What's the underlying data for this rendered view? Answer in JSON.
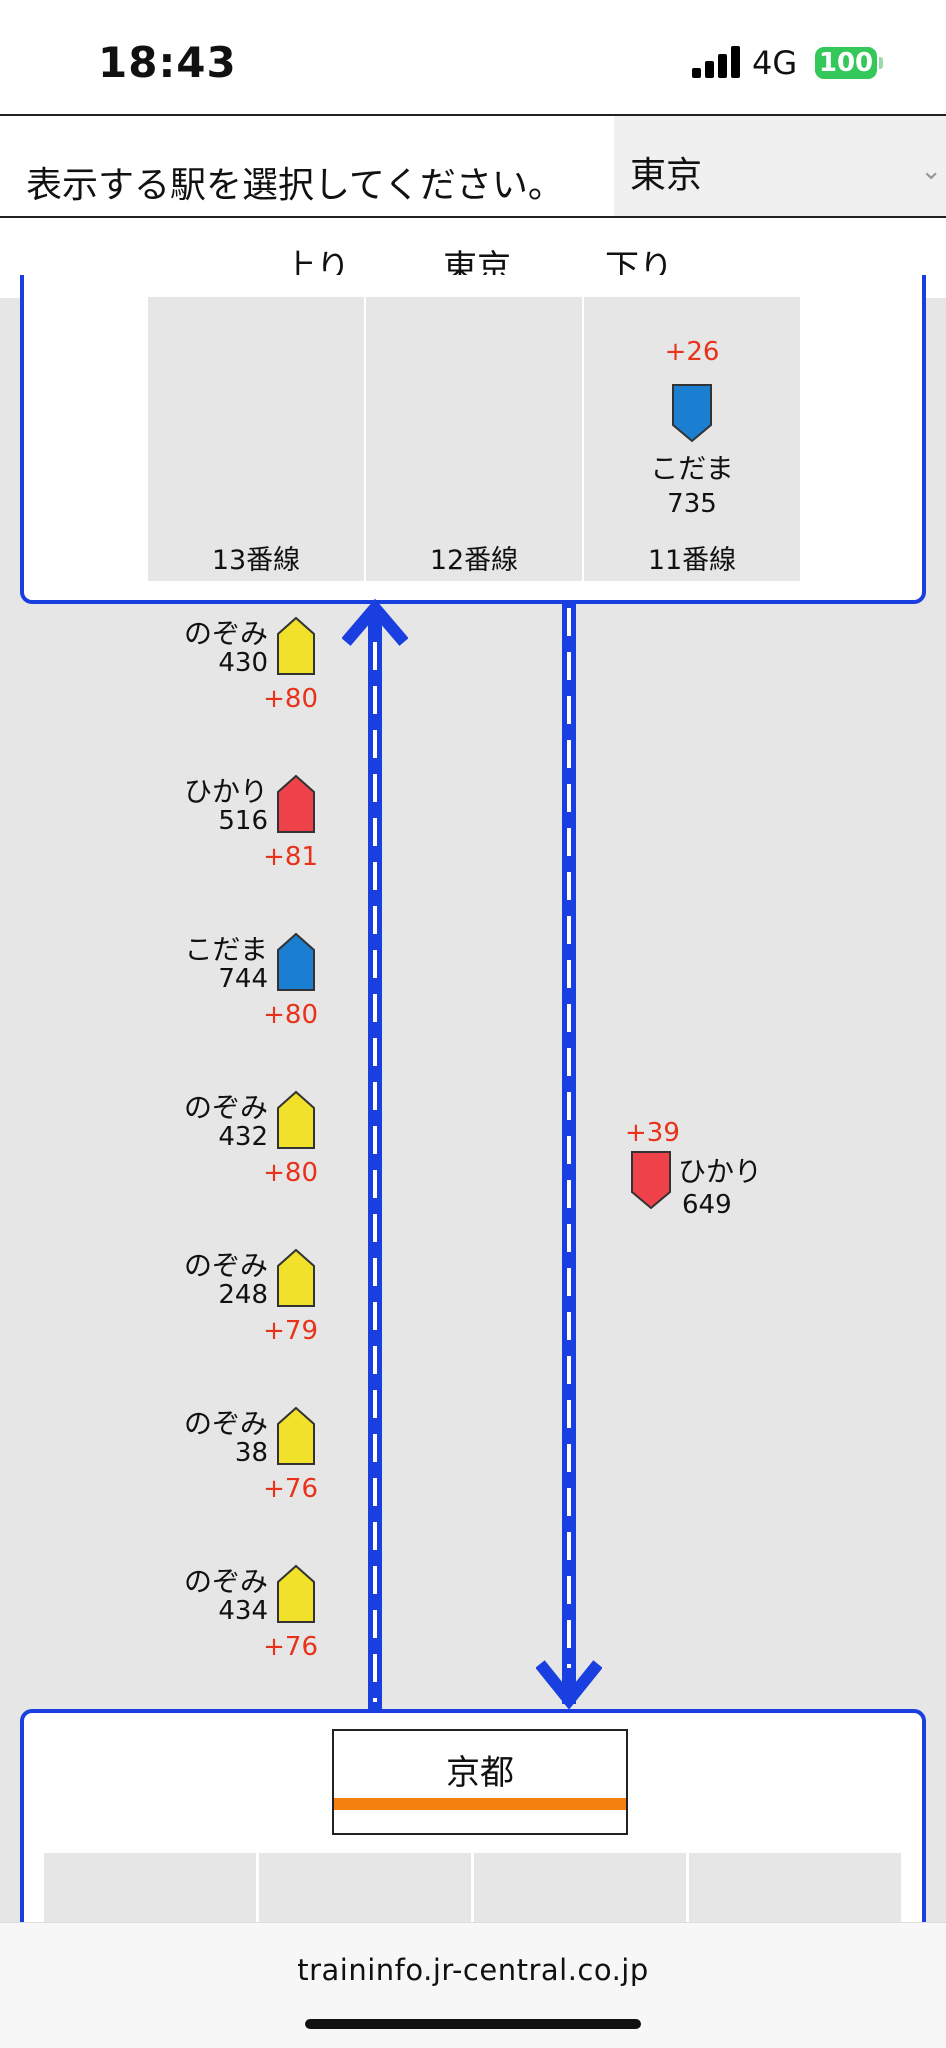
{
  "status": {
    "time": "18:43",
    "network": "4G",
    "battery": "100"
  },
  "selector": {
    "label": "表示する駅を選択してください。",
    "value": "東京"
  },
  "directions": {
    "up": "上り",
    "station": "東京",
    "down": "下り"
  },
  "tokyo": {
    "tracks": [
      "13番線",
      "12番線",
      "11番線"
    ],
    "train": {
      "name": "こだま",
      "number": "735",
      "delay": "+26",
      "color": "#1a7fd0"
    }
  },
  "up_trains": [
    {
      "name": "のぞみ",
      "number": "430",
      "delay": "+80",
      "color": "#f1e12a"
    },
    {
      "name": "ひかり",
      "number": "516",
      "delay": "+81",
      "color": "#f0424a"
    },
    {
      "name": "こだま",
      "number": "744",
      "delay": "+80",
      "color": "#1a7fd0"
    },
    {
      "name": "のぞみ",
      "number": "432",
      "delay": "+80",
      "color": "#f1e12a"
    },
    {
      "name": "のぞみ",
      "number": "248",
      "delay": "+79",
      "color": "#f1e12a"
    },
    {
      "name": "のぞみ",
      "number": "38",
      "delay": "+76",
      "color": "#f1e12a"
    },
    {
      "name": "のぞみ",
      "number": "434",
      "delay": "+76",
      "color": "#f1e12a"
    }
  ],
  "down_trains": [
    {
      "name": "ひかり",
      "number": "649",
      "delay": "+39",
      "color": "#f0424a"
    }
  ],
  "kyoto": {
    "name": "京都",
    "stripe_color": "#f5800e"
  },
  "browser": {
    "url": "traininfo.jr-central.co.jp"
  },
  "colors": {
    "rail": "#1a3fe0",
    "delay": "#e8321a"
  }
}
